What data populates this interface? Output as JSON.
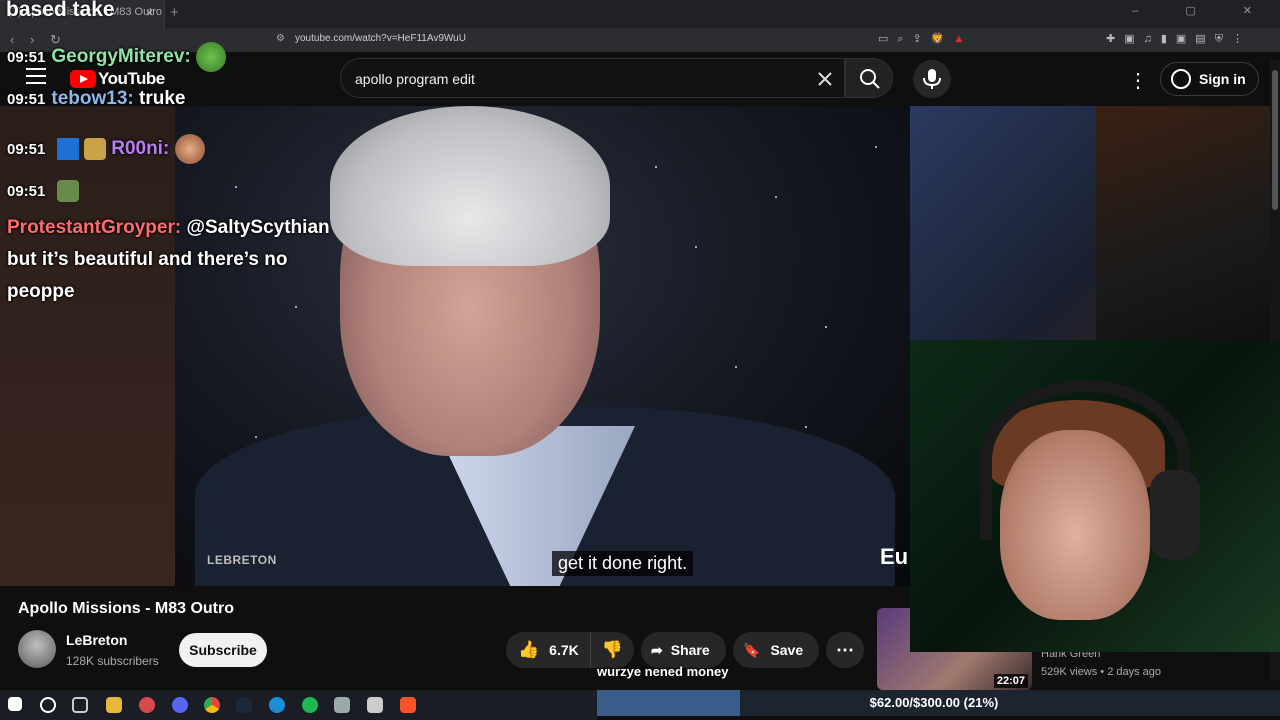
{
  "browser": {
    "tab_title": "(3) Apollo Missions - M83 Outro",
    "tab_close": "×",
    "new_tab": "+",
    "window_controls": "–  ▢  ✕",
    "nav_back": "‹",
    "nav_forward": "›",
    "nav_reload": "↻",
    "url": "youtube.com/watch?v=HeF11Av9WuU"
  },
  "chat": {
    "banner": "based take",
    "messages": [
      {
        "time": "09:51",
        "user": "GeorgyMiterev:",
        "user_color": "#8fe3a8",
        "text": ""
      },
      {
        "time": "09:51",
        "user": "tebow13:",
        "user_color": "#8ab8e8",
        "text": "truke"
      },
      {
        "time": "09:51",
        "user": "R00ni:",
        "user_color": "#b97cf2",
        "text": ""
      },
      {
        "time": "09:51",
        "user": "",
        "user_color": "#ffffff",
        "text": ""
      }
    ],
    "long_message": {
      "user": "ProtestantGroyper:",
      "user_color": "#ff6b6b",
      "mention": "@SaltyScythian",
      "line1": "but it’s beautiful and there’s no",
      "line2": "peoppe"
    }
  },
  "youtube": {
    "logo_text": "YouTube",
    "search_value": "apollo program edit",
    "sign_in": "Sign in"
  },
  "video": {
    "watermark": "LEBRETON",
    "subtitle": "get it done right.",
    "edge_text": "Eu",
    "title": "Apollo Missions - M83 Outro",
    "channel": "LeBreton",
    "subscribers": "128K subscribers",
    "subscribe": "Subscribe",
    "likes": "6.7K",
    "share": "Share",
    "save": "Save"
  },
  "stream": {
    "donation_text": "wurzye nened money",
    "goal_text": "$62.00/$300.00 (21%)",
    "goal_fraction": 0.21
  },
  "sidebar_video": {
    "duration": "22:07",
    "channel": "Hank Green",
    "meta": "529K views • 2 days ago"
  },
  "colors": {
    "accent_red": "#ff0000",
    "bg": "#0f0f0f"
  }
}
